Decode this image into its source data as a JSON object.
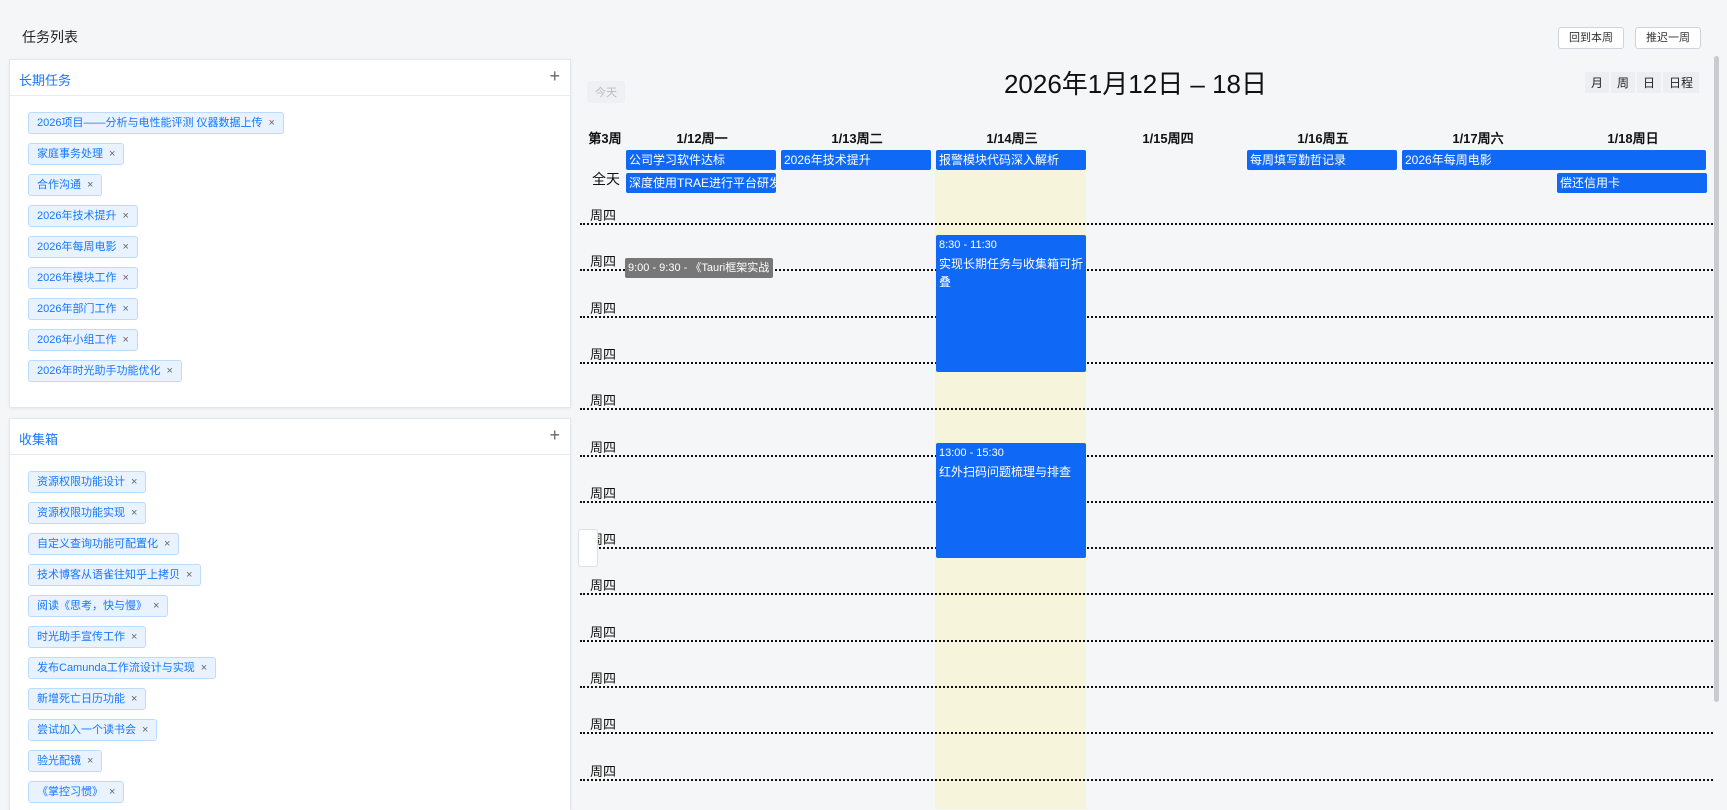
{
  "header": {
    "title": "任务列表",
    "back_week": "回到本周",
    "postpone_week": "推迟一周"
  },
  "long_term": {
    "title": "长期任务",
    "add_icon": "plus-icon",
    "tags": [
      "2026项目——分析与电性能评测 仪器数据上传",
      "家庭事务处理",
      "合作沟通",
      "2026年技术提升",
      "2026年每周电影",
      "2026年模块工作",
      "2026年部门工作",
      "2026年小组工作",
      "2026年时光助手功能优化"
    ]
  },
  "inbox": {
    "title": "收集箱",
    "add_icon": "plus-icon",
    "tags": [
      "资源权限功能设计",
      "资源权限功能实现",
      "自定义查询功能可配置化",
      "技术博客从语雀往知乎上拷贝",
      "阅读《思考，快与慢》",
      "时光助手宣传工作",
      "发布Camunda工作流设计与实现",
      "新增死亡日历功能",
      "尝试加入一个读书会",
      "验光配镜",
      "《掌控习惯》"
    ]
  },
  "calendar": {
    "title": "2026年1月12日 – 18日",
    "today_btn": "今天",
    "views": [
      "月",
      "周",
      "日",
      "日程"
    ],
    "week_label": "第3周",
    "all_day_label": "全天",
    "days": [
      "1/12周一",
      "1/13周二",
      "1/14周三",
      "1/15周四",
      "1/16周五",
      "1/17周六",
      "1/18周日"
    ],
    "all_day_events": [
      {
        "title": "公司学习软件达标",
        "day": 0,
        "span": 1,
        "row": 0
      },
      {
        "title": "深度使用TRAE进行平台研发",
        "day": 0,
        "span": 1,
        "row": 1
      },
      {
        "title": "2026年技术提升",
        "day": 1,
        "span": 1,
        "row": 0
      },
      {
        "title": "报警模块代码深入解析",
        "day": 2,
        "span": 1,
        "row": 0
      },
      {
        "title": "每周填写勤哲记录",
        "day": 4,
        "span": 1,
        "row": 0
      },
      {
        "title": "2026年每周电影",
        "day": 5,
        "span": 2,
        "row": 0
      },
      {
        "title": "偿还信用卡",
        "day": 6,
        "span": 1,
        "row": 1
      }
    ],
    "slot_label": "周四",
    "timed_events": [
      {
        "time": "9:00 - 9:30 - 《Tauri框架实战",
        "day": 0
      },
      {
        "time": "8:30 - 11:30",
        "title": "实现长期任务与收集箱可折叠",
        "day": 2
      },
      {
        "time": "13:00 - 15:30",
        "title": "红外扫码问题梳理与排查",
        "day": 2
      }
    ]
  }
}
